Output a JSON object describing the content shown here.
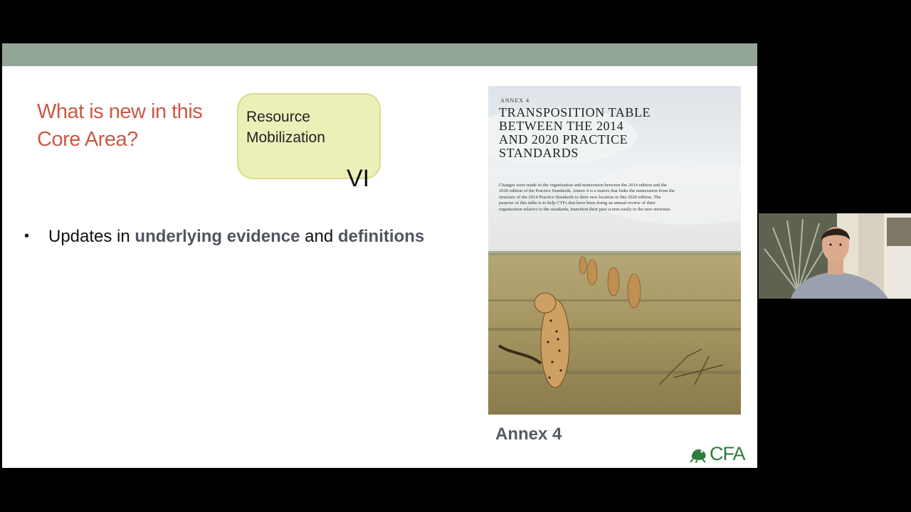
{
  "slide": {
    "title": "What is new in this Core Area?",
    "core_area": {
      "name": "Resource Mobilization",
      "number": "VI"
    },
    "bullet": {
      "text_1": "Updates in ",
      "bold_1": "underlying evidence",
      "text_2": " and ",
      "bold_2": "definitions"
    },
    "annex_cover": {
      "kicker": "ANNEX 4",
      "title": "TRANSPOSITION TABLE\nBETWEEN THE 2014\nAND 2020 PRACTICE\nSTANDARDS",
      "body": "Changes were made in the organization and numeration between the 2014 edition and the 2020 edition of the Practice Standards. Annex 4 is a matrix that links the numeration from the structure of the 2014 Practice Standards to their new location in this 2020 edition. The purpose of this table is to help CTFs that have been doing an annual review of their organization relative to the standards, transition their past scores easily to the new structure."
    },
    "annex_label": "Annex 4",
    "logo_text": "CFA"
  },
  "colors": {
    "band": "#93a597",
    "title": "#c95a45",
    "box_fill": "#ecefb8",
    "emphasis": "#515561",
    "logo": "#2e7d3b"
  }
}
